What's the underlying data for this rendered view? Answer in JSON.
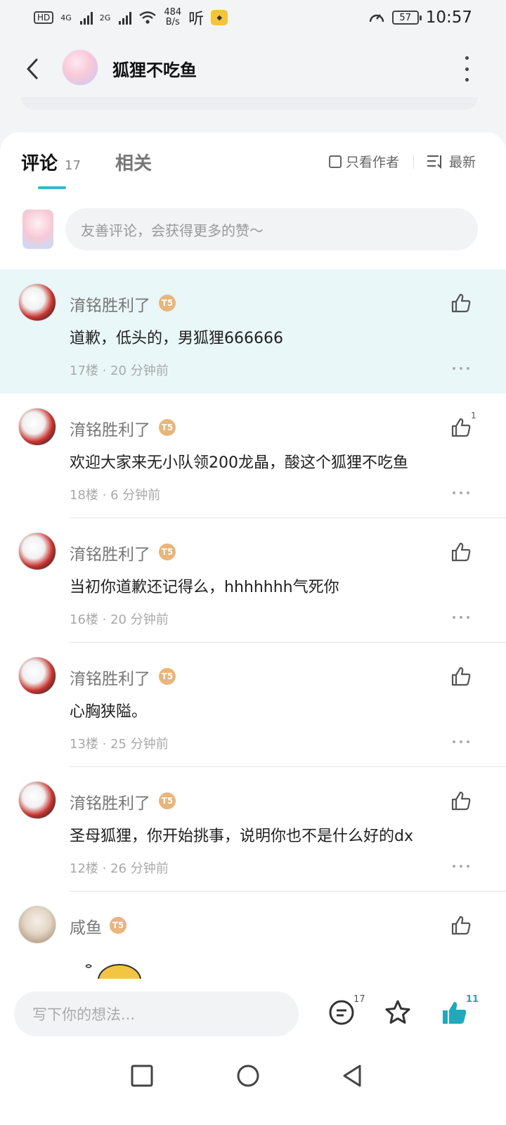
{
  "status_bar": {
    "hd_label": "HD",
    "net1": "4G",
    "net2": "2G",
    "speed_value": "484",
    "speed_unit": "B/s",
    "listen_label": "听",
    "battery": "57",
    "time": "10:57"
  },
  "header": {
    "title": "狐狸不吃鱼"
  },
  "tabs": {
    "comments_label": "评论",
    "comments_count": "17",
    "related_label": "相关",
    "only_author_label": "只看作者",
    "sort_label": "最新"
  },
  "comment_input": {
    "placeholder": "友善评论，会获得更多的赞～"
  },
  "comments": [
    {
      "name": "淯铭胜利了",
      "level": "T5",
      "text": "道歉，低头的，男狐狸666666",
      "meta": "17楼 · 20 分钟前",
      "likes": ""
    },
    {
      "name": "淯铭胜利了",
      "level": "T5",
      "text": "欢迎大家来无小队领200龙晶，酸这个狐狸不吃鱼",
      "meta": "18楼 · 6 分钟前",
      "likes": "1"
    },
    {
      "name": "淯铭胜利了",
      "level": "T5",
      "text": "当初你道歉还记得么，hhhhhhh气死你",
      "meta": "16楼 · 20 分钟前",
      "likes": ""
    },
    {
      "name": "淯铭胜利了",
      "level": "T5",
      "text": "心胸狭隘。",
      "meta": "13楼 · 25 分钟前",
      "likes": ""
    },
    {
      "name": "淯铭胜利了",
      "level": "T5",
      "text": "圣母狐狸，你开始挑事，说明你也不是什么好的dx",
      "meta": "12楼 · 26 分钟前",
      "likes": ""
    },
    {
      "name": "咸鱼",
      "level": "T5",
      "text": "",
      "meta": "",
      "likes": ""
    }
  ],
  "bottom_bar": {
    "placeholder": "写下你的想法...",
    "comment_count": "17",
    "like_count": "11",
    "accent_color": "#1fa9bb"
  },
  "icons": {
    "back": "chevron-left-icon",
    "more": "more-vertical-icon",
    "like": "thumbs-up-icon",
    "comment": "chat-bubble-icon",
    "favorite": "star-icon",
    "sort": "sort-list-icon"
  }
}
